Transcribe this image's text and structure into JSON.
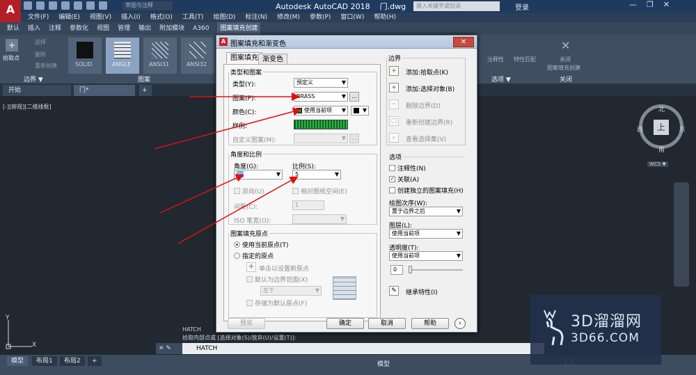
{
  "app": {
    "title": "Autodesk AutoCAD 2018",
    "file_tab": "门.dwg",
    "logo": "A",
    "workspace": "草图与注释",
    "search_placeholder": "键入关键字或短语",
    "login": "登录",
    "window_controls": [
      "—",
      "❐",
      "✕"
    ]
  },
  "menu": [
    "文件(F)",
    "编辑(E)",
    "视图(V)",
    "插入(I)",
    "格式(O)",
    "工具(T)",
    "绘图(D)",
    "标注(N)",
    "修改(M)",
    "参数(P)",
    "窗口(W)",
    "帮助(H)"
  ],
  "ribbon_tabs": [
    "默认",
    "插入",
    "注释",
    "参数化",
    "视图",
    "管理",
    "输出",
    "附加模块",
    "A360",
    "图案填充创建"
  ],
  "ribbon": {
    "boundary_panel": {
      "label": "边界 ▼",
      "pick_label": "拾取点",
      "select_label": "选择",
      "remove_label": "删除",
      "recreate_label": "重新创建"
    },
    "pattern_panel": {
      "label": "图案",
      "thumbs": [
        "SOLID",
        "ANGLE",
        "ANSI31",
        "ANSI32"
      ]
    },
    "right": {
      "annotative": "注释性",
      "match": "特性匹配",
      "options_label": "选项 ▼",
      "close_label": "关闭",
      "close_sub": "图案填充创建",
      "close_panel": "关闭"
    }
  },
  "doc_tabs": [
    "开始",
    "门*",
    "+"
  ],
  "view_label": "[-][俯视][二维线框]",
  "compass": {
    "n": "北",
    "s": "南",
    "e": "东",
    "w": "西",
    "center": "上",
    "wcs": "WCS ▼"
  },
  "command": {
    "history_1": "HATCH",
    "history_2": "拾取内部点或 [选择对象(S)/放弃(U)/设置(T)]:",
    "input": "HATCH"
  },
  "layout_tabs": [
    "模型",
    "布局1",
    "布局2",
    "+"
  ],
  "status": {
    "model": "模型",
    "scale": "1:1"
  },
  "ucs": {
    "x": "X",
    "y": "Y"
  },
  "watermark": {
    "brand": "3D溜溜网",
    "site": "3D66.COM"
  },
  "dialog": {
    "title": "图案填充和渐变色",
    "tabs": [
      "图案填充",
      "渐变色"
    ],
    "type_group": {
      "legend": "类型和图案",
      "type_label": "类型(Y):",
      "type_value": "预定义",
      "pattern_label": "图案(P):",
      "pattern_value": "BRASS",
      "color_label": "颜色(C):",
      "color_value": "使用当前项",
      "sample_label": "样例:",
      "custom_label": "自定义图案(M):"
    },
    "angle_group": {
      "legend": "角度和比例",
      "angle_label": "角度(G):",
      "angle_value": "90",
      "scale_label": "比例(S):",
      "scale_value": "5",
      "double_label": "双向(U)",
      "relative_label": "相对图纸空间(E)",
      "spacing_label": "间距(C):",
      "spacing_value": "1",
      "iso_label": "ISO 笔宽(O):"
    },
    "origin_group": {
      "legend": "图案填充原点",
      "use_current": "使用当前原点(T)",
      "specified": "指定的原点",
      "click_set": "单击以设置新原点",
      "default_extent": "默认为边界范围(X)",
      "extent_value": "左下",
      "store_default": "存储为默认原点(F)"
    },
    "boundary": {
      "legend": "边界",
      "add_pick": "添加:拾取点(K)",
      "add_select": "添加:选择对象(B)",
      "remove": "删除边界(D)",
      "recreate": "重新创建边界(R)",
      "view_sel": "查看选择集(V)"
    },
    "options": {
      "legend": "选项",
      "annotative": "注释性(N)",
      "associative": "关联(A)",
      "independent": "创建独立的图案填充(H)",
      "draw_order_label": "绘图次序(W):",
      "draw_order_value": "置于边界之后",
      "layer_label": "图层(L):",
      "layer_value": "使用当前项",
      "transparency_label": "透明度(T):",
      "transparency_value": "使用当前项",
      "transparency_num": "0"
    },
    "inherit": "继承特性(I)",
    "buttons": {
      "preview": "预览",
      "ok": "确定",
      "cancel": "取消",
      "help": "帮助"
    }
  }
}
